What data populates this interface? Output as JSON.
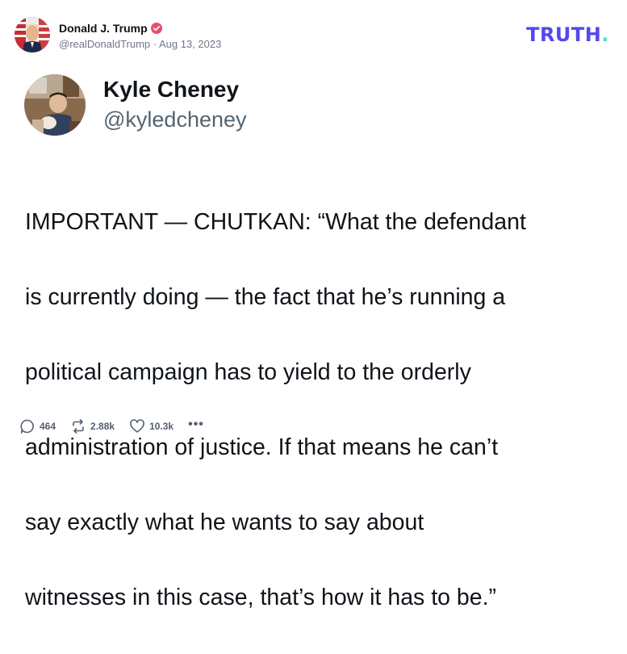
{
  "post": {
    "author_name": "Donald J. Trump",
    "handle_and_date": "@realDonaldTrump · Aug 13, 2023",
    "verified_icon": "verified-badge-icon",
    "brand_logo": {
      "text": "TRUTH",
      "dot": ".",
      "color": "#5448ee",
      "dot_color": "#5ad6c4"
    }
  },
  "embedded": {
    "name": "Kyle Cheney",
    "handle": "@kyledcheney",
    "text_lines": [
      "IMPORTANT — CHUTKAN: “What the defendant",
      "is currently doing — the fact that he’s running a",
      "political campaign has to yield to the orderly",
      "administration of justice. If that means he can’t",
      "say exactly what he wants to say about",
      "witnesses in this case, that’s how it has to be.”"
    ]
  },
  "actions": {
    "replies": "464",
    "retruths": "2.88k",
    "likes": "10.3k",
    "more": "•••"
  },
  "colors": {
    "accent": "#5448ee",
    "muted_text": "#707787",
    "verified_badge": "#ea4c6b"
  }
}
